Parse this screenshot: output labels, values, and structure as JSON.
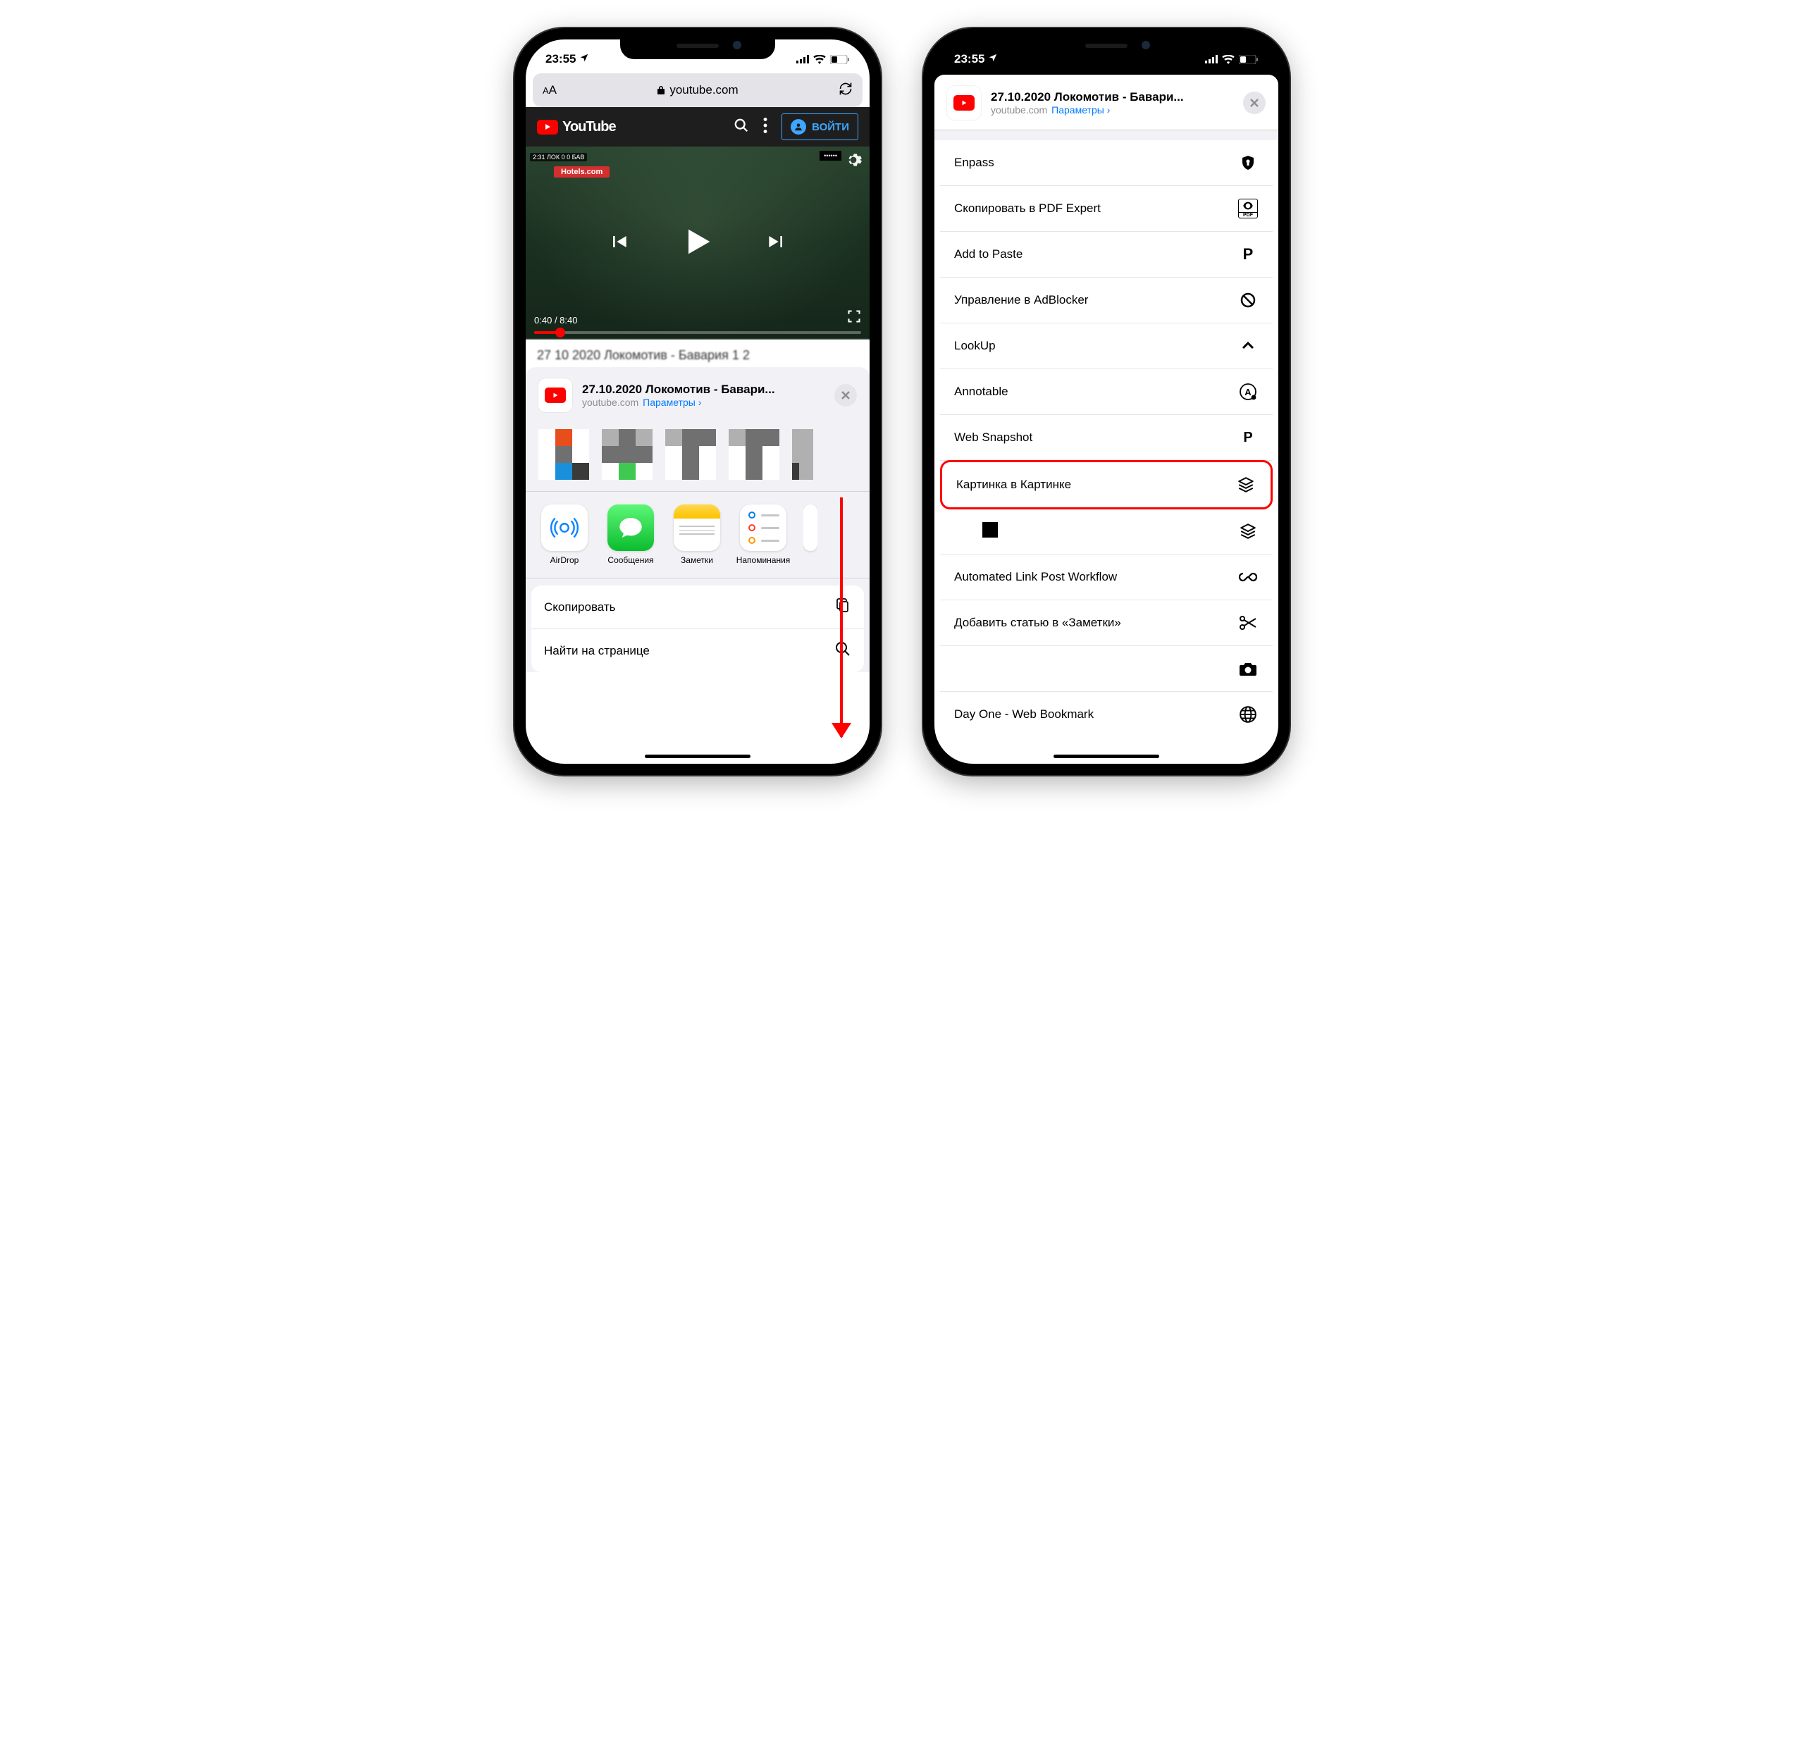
{
  "status": {
    "time": "23:55",
    "location_icon": "location-arrow"
  },
  "address_bar": {
    "url_display": "youtube.com"
  },
  "youtube": {
    "brand": "YouTube",
    "signin_label": "ВОЙТИ",
    "video": {
      "banner": "Hotels.com",
      "score_prefix": "2:31  ЛОК  0  0  БАВ",
      "current_time": "0:40",
      "duration": "8:40"
    }
  },
  "share": {
    "title": "27.10.2020 Локомотив - Бавари...",
    "domain": "youtube.com",
    "options_label": "Параметры"
  },
  "apps": [
    {
      "label": "AirDrop",
      "icon": "airdrop"
    },
    {
      "label": "Сообщения",
      "icon": "messages"
    },
    {
      "label": "Заметки",
      "icon": "notes"
    },
    {
      "label": "Напоминания",
      "icon": "reminders"
    }
  ],
  "left_actions": [
    {
      "label": "Скопировать",
      "icon": "copy"
    },
    {
      "label": "Найти на странице",
      "icon": "search"
    }
  ],
  "right_actions": [
    {
      "label": "Enpass",
      "icon": "shield"
    },
    {
      "label": "Скопировать в PDF Expert",
      "icon": "pdf"
    },
    {
      "label": "Add to Paste",
      "icon": "p-bold"
    },
    {
      "label": "Управление в AdBlocker",
      "icon": "block"
    },
    {
      "label": "LookUp",
      "icon": "chevron-up"
    },
    {
      "label": "Annotable",
      "icon": "circle-a"
    },
    {
      "label": "Web Snapshot",
      "icon": "p-small"
    },
    {
      "label": "Картинка в Картинке",
      "icon": "stack",
      "highlighted": true
    },
    {
      "label": "",
      "icon": "stack",
      "blank_icon": true
    },
    {
      "label": "Automated Link Post Workflow",
      "icon": "infinity"
    },
    {
      "label": "Добавить статью в «Заметки»",
      "icon": "scissors"
    },
    {
      "label": "",
      "icon": "camera"
    },
    {
      "label": "Day One - Web Bookmark",
      "icon": "globe"
    }
  ]
}
